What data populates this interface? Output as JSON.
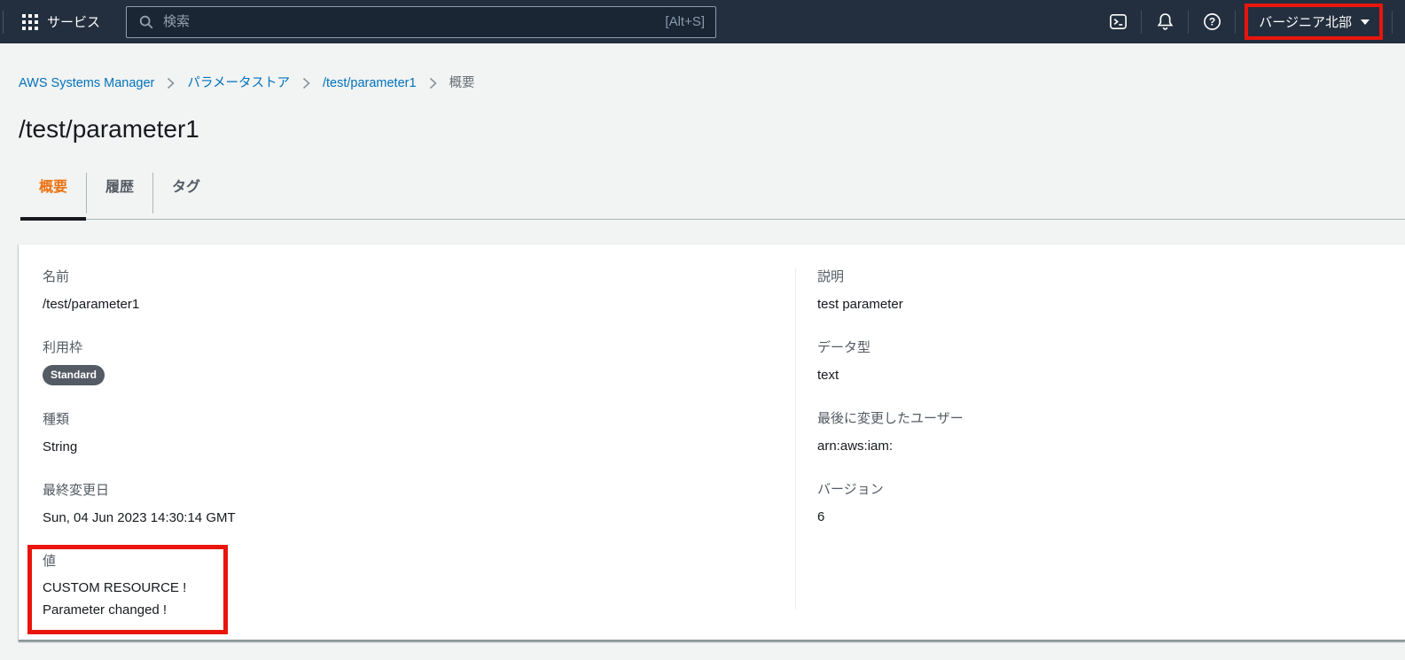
{
  "topbar": {
    "services_label": "サービス",
    "search": {
      "placeholder": "検索",
      "shortcut": "[Alt+S]"
    },
    "region": "バージニア北部"
  },
  "breadcrumb": [
    "AWS Systems Manager",
    "パラメータストア",
    "/test/parameter1",
    "概要"
  ],
  "page_title": "/test/parameter1",
  "tabs": [
    "概要",
    "履歴",
    "タグ"
  ],
  "overview": {
    "left": [
      {
        "label": "名前",
        "value": "/test/parameter1"
      },
      {
        "label": "利用枠",
        "value": "Standard"
      },
      {
        "label": "種類",
        "value": "String"
      },
      {
        "label": "最終変更日",
        "value": "Sun, 04 Jun 2023 14:30:14 GMT"
      },
      {
        "label": "値",
        "lines": [
          "CUSTOM RESOURCE !",
          "Parameter changed !"
        ]
      }
    ],
    "right": [
      {
        "label": "説明",
        "value": "test parameter"
      },
      {
        "label": "データ型",
        "value": "text"
      },
      {
        "label": "最後に変更したユーザー",
        "value": "arn:aws:iam:"
      },
      {
        "label": "バージョン",
        "value": "6"
      }
    ]
  },
  "colors": {
    "topbar_bg": "#232f3e",
    "link_blue": "#0073bb",
    "tab_active_orange": "#ec7211",
    "annotation_red": "#e8150d",
    "badge_bg": "#545b64"
  }
}
